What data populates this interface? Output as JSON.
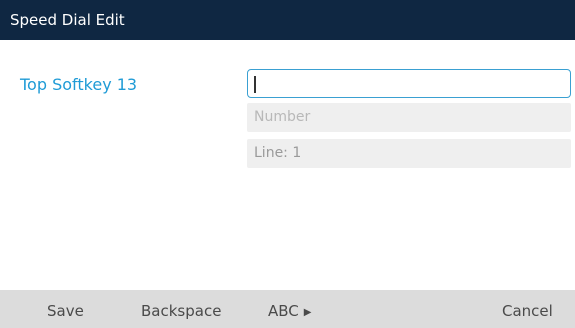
{
  "header": {
    "title": "Speed Dial Edit"
  },
  "form": {
    "key_label": "Top Softkey 13",
    "name_value": "",
    "number_placeholder": "Number",
    "line_value": "Line: 1"
  },
  "softkeys": {
    "save": "Save",
    "backspace": "Backspace",
    "abc": "ABC",
    "abc_icon": "triangle-right-icon",
    "cancel": "Cancel"
  },
  "colors": {
    "header_bg": "#0f2742",
    "accent": "#1f9bd6",
    "softkey_bar": "#dcdcdc"
  }
}
